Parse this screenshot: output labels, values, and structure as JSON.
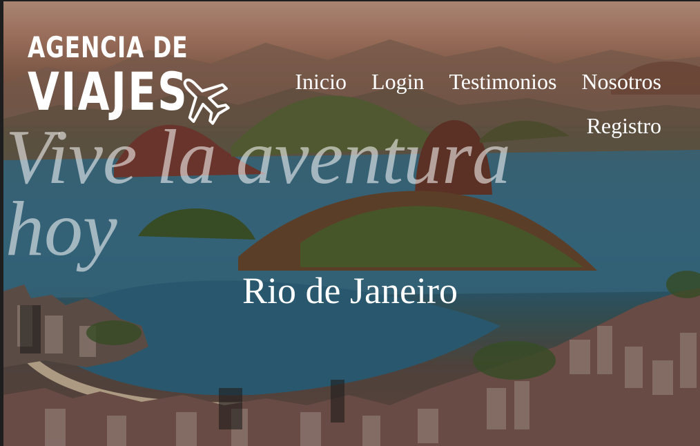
{
  "logo": {
    "line1": "AGENCIA DE",
    "line2": "VIAJES",
    "icon": "airplane-icon"
  },
  "nav": {
    "items": [
      {
        "label": "Inicio"
      },
      {
        "label": "Login"
      },
      {
        "label": "Testimonios"
      },
      {
        "label": "Nosotros"
      },
      {
        "label": "Registro"
      }
    ]
  },
  "hero": {
    "headline": "Vive la aventura hoy",
    "location": "Rio de Janeiro",
    "background": "rio-de-janeiro-photo"
  },
  "colors": {
    "text": "#ffffff",
    "headline_text": "rgba(255,255,255,0.55)",
    "ocean": "#2f6c86",
    "sky": "#c9a08a"
  }
}
